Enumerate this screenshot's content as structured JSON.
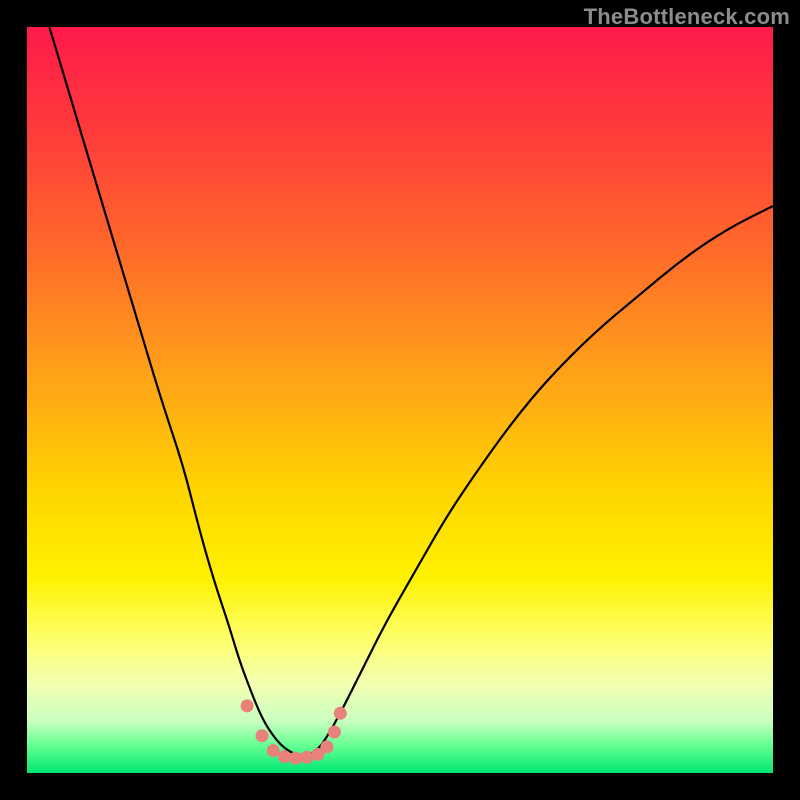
{
  "watermark": "TheBottleneck.com",
  "colors": {
    "bg": "#000000",
    "curve": "#000000",
    "points": "#e78179",
    "gradient_stops": [
      {
        "offset": 0.0,
        "color": "#ff1a4b"
      },
      {
        "offset": 0.14,
        "color": "#ff3b3b"
      },
      {
        "offset": 0.3,
        "color": "#ff6a2a"
      },
      {
        "offset": 0.46,
        "color": "#ffa019"
      },
      {
        "offset": 0.62,
        "color": "#ffd400"
      },
      {
        "offset": 0.74,
        "color": "#fff200"
      },
      {
        "offset": 0.82,
        "color": "#fdff6b"
      },
      {
        "offset": 0.88,
        "color": "#f3ffb0"
      },
      {
        "offset": 0.93,
        "color": "#c9ffc1"
      },
      {
        "offset": 0.965,
        "color": "#5fff8f"
      },
      {
        "offset": 1.0,
        "color": "#00e673"
      }
    ]
  },
  "chart_data": {
    "type": "line",
    "title": "",
    "xlabel": "",
    "ylabel": "",
    "xlim": [
      0,
      100
    ],
    "ylim": [
      0,
      100
    ],
    "series": [
      {
        "name": "bottleneck-curve",
        "x": [
          3,
          6,
          9,
          12,
          15,
          18,
          21,
          23,
          25,
          27,
          28.5,
          30,
          31,
          32,
          33,
          34,
          35,
          36,
          37,
          38,
          39,
          40,
          42,
          45,
          48,
          52,
          56,
          60,
          65,
          70,
          76,
          82,
          88,
          94,
          100
        ],
        "y": [
          100,
          90,
          80,
          70,
          60,
          50,
          41,
          33,
          26,
          20,
          15,
          11,
          8.5,
          6.5,
          5,
          3.8,
          3,
          2.5,
          2.3,
          2.5,
          3.2,
          4.5,
          8,
          14,
          20,
          27,
          34,
          40,
          47,
          53,
          59,
          64,
          69,
          73,
          76
        ]
      }
    ],
    "scatter_points": {
      "name": "highlight-points",
      "x": [
        29.5,
        31.5,
        33,
        34.5,
        36,
        37.5,
        39,
        40.2,
        41.2,
        42
      ],
      "y": [
        9,
        5,
        3,
        2.2,
        2,
        2.1,
        2.5,
        3.5,
        5.5,
        8
      ]
    }
  }
}
